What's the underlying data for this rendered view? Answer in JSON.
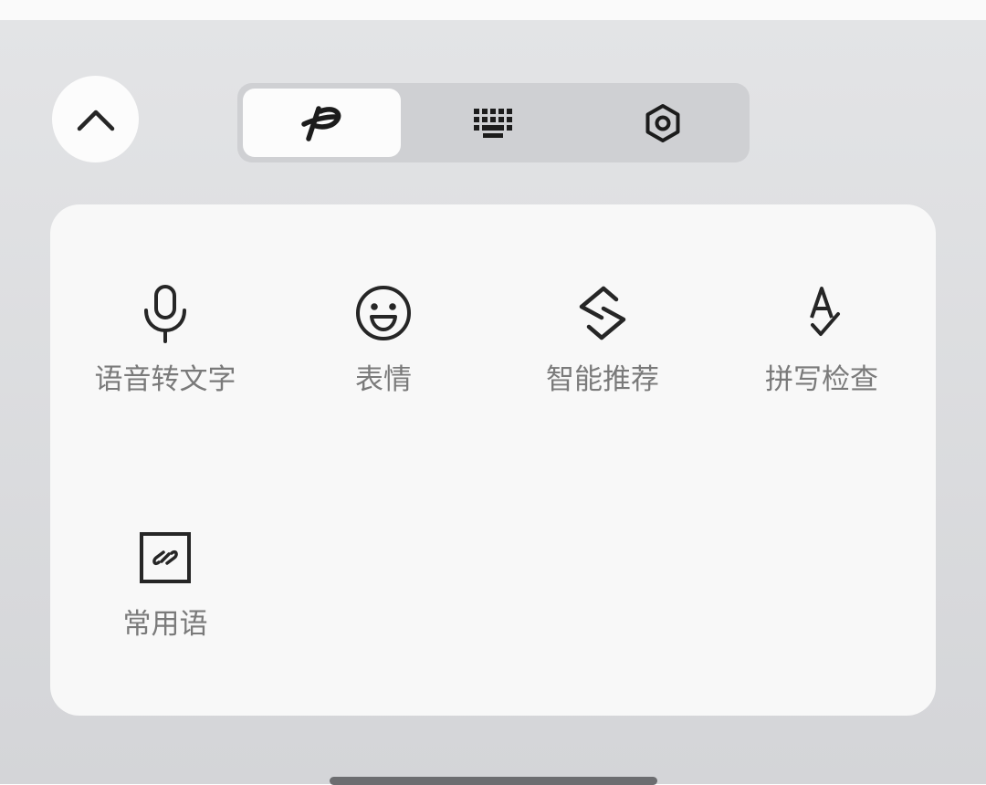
{
  "top_button": {
    "icon": "chevron-up-icon"
  },
  "mode_tabs": [
    {
      "icon": "handwriting-icon",
      "active": true
    },
    {
      "icon": "keyboard-icon",
      "active": false
    },
    {
      "icon": "settings-icon",
      "active": false
    }
  ],
  "tools": [
    {
      "label": "语音转文字",
      "icon": "microphone-icon"
    },
    {
      "label": "表情",
      "icon": "emoji-icon"
    },
    {
      "label": "智能推荐",
      "icon": "smart-suggest-icon"
    },
    {
      "label": "拼写检查",
      "icon": "spell-check-icon"
    },
    {
      "label": "常用语",
      "icon": "phrases-icon"
    }
  ],
  "colors": {
    "panel_bg": "#dcdde0",
    "card_bg": "#f8f8f8",
    "active_tab_bg": "#fcfcfc",
    "label_text": "#7a7a7a",
    "icon_stroke": "#262626"
  }
}
